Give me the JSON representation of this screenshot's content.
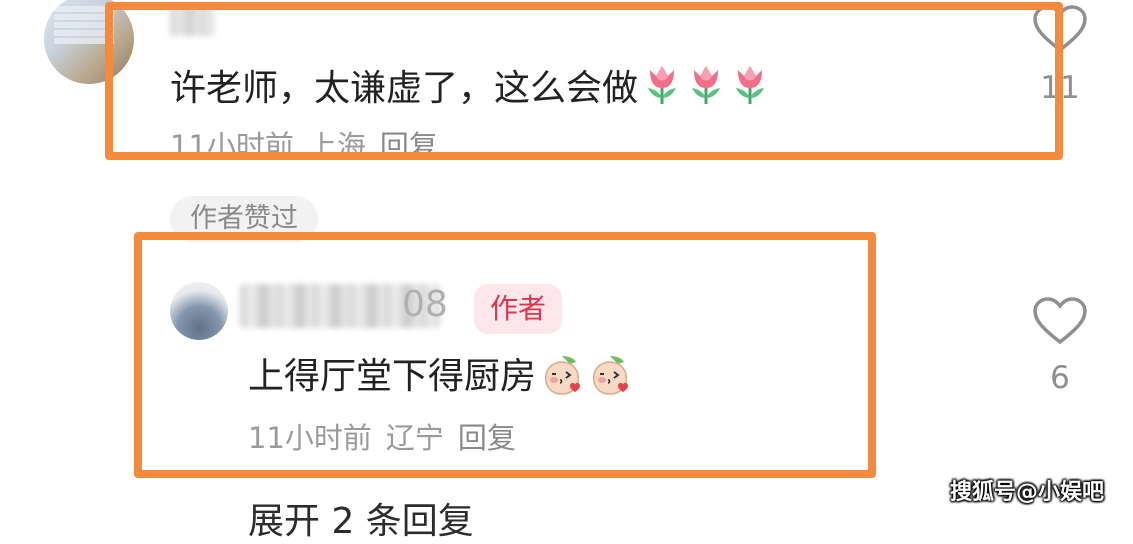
{
  "comment": {
    "text": "许老师，太谦虚了，这么会做",
    "emoji": "tulip",
    "emoji_count": 3,
    "time": "11小时前",
    "location": "上海",
    "reply_label": "回复",
    "likes": "11"
  },
  "author_liked_label": "作者赞过",
  "reply": {
    "name_visible_tail": "08",
    "author_badge": "作者",
    "text": "上得厅堂下得厨房",
    "emoji": "peach-kiss",
    "emoji_count": 2,
    "time": "11小时前",
    "location": "辽宁",
    "reply_label": "回复",
    "likes": "6"
  },
  "expand_label": "展开 2 条回复",
  "watermark": "搜狐号@小娱吧",
  "colors": {
    "highlight": "#f5893c",
    "badge_bg": "#fde7ea",
    "badge_text": "#e0334f",
    "meta_text": "#9a9a9a"
  },
  "icons": [
    "heart-outline-icon",
    "tulip-emoji",
    "peach-kiss-emoji"
  ]
}
